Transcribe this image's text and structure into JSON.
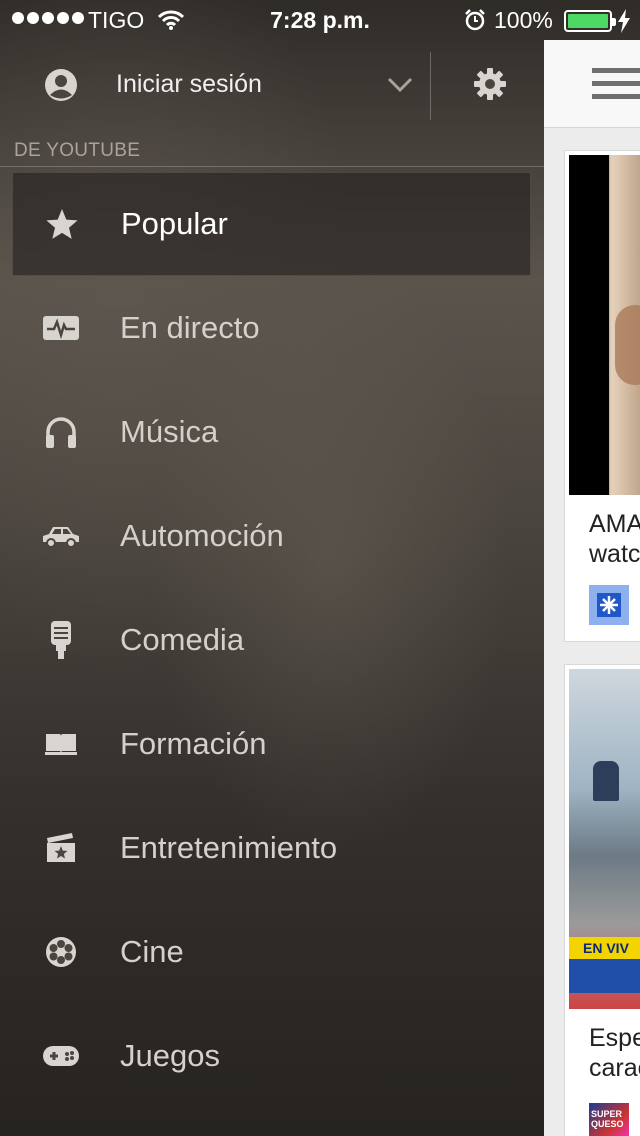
{
  "status_bar": {
    "carrier": "TIGO",
    "time": "7:28 p.m.",
    "battery": "100%",
    "battery_color": "#4cd964"
  },
  "header": {
    "avatar_icon": "account-circle-icon",
    "signin_label": "Iniciar sesión",
    "chevron_icon": "chevron-down-icon",
    "settings_icon": "gear-icon"
  },
  "section": {
    "label": "DE YOUTUBE"
  },
  "menu": {
    "items": [
      {
        "label": "Popular",
        "icon": "star-icon",
        "selected": true
      },
      {
        "label": "En directo",
        "icon": "live-pulse-icon",
        "selected": false
      },
      {
        "label": "Música",
        "icon": "headphones-icon",
        "selected": false
      },
      {
        "label": "Automoción",
        "icon": "car-icon",
        "selected": false
      },
      {
        "label": "Comedia",
        "icon": "microphone-icon",
        "selected": false
      },
      {
        "label": "Formación",
        "icon": "open-book-icon",
        "selected": false
      },
      {
        "label": "Entretenimiento",
        "icon": "clapperboard-icon",
        "selected": false
      },
      {
        "label": "Cine",
        "icon": "film-reel-icon",
        "selected": false
      },
      {
        "label": "Juegos",
        "icon": "gamepad-icon",
        "selected": false
      }
    ]
  },
  "feed": {
    "menu_icon": "hamburger-icon",
    "cards": [
      {
        "title_line1": "AMA",
        "title_line2": "watc"
      },
      {
        "title_line1": "Espe",
        "title_line2": "carac",
        "banner_text": "EN VIV",
        "channel_avatar_text": "SUPER QUESO"
      }
    ]
  },
  "colors": {
    "sidebar_text": "#d4d0cb",
    "section_label": "#a9a39c",
    "feed_background": "#ececec"
  }
}
